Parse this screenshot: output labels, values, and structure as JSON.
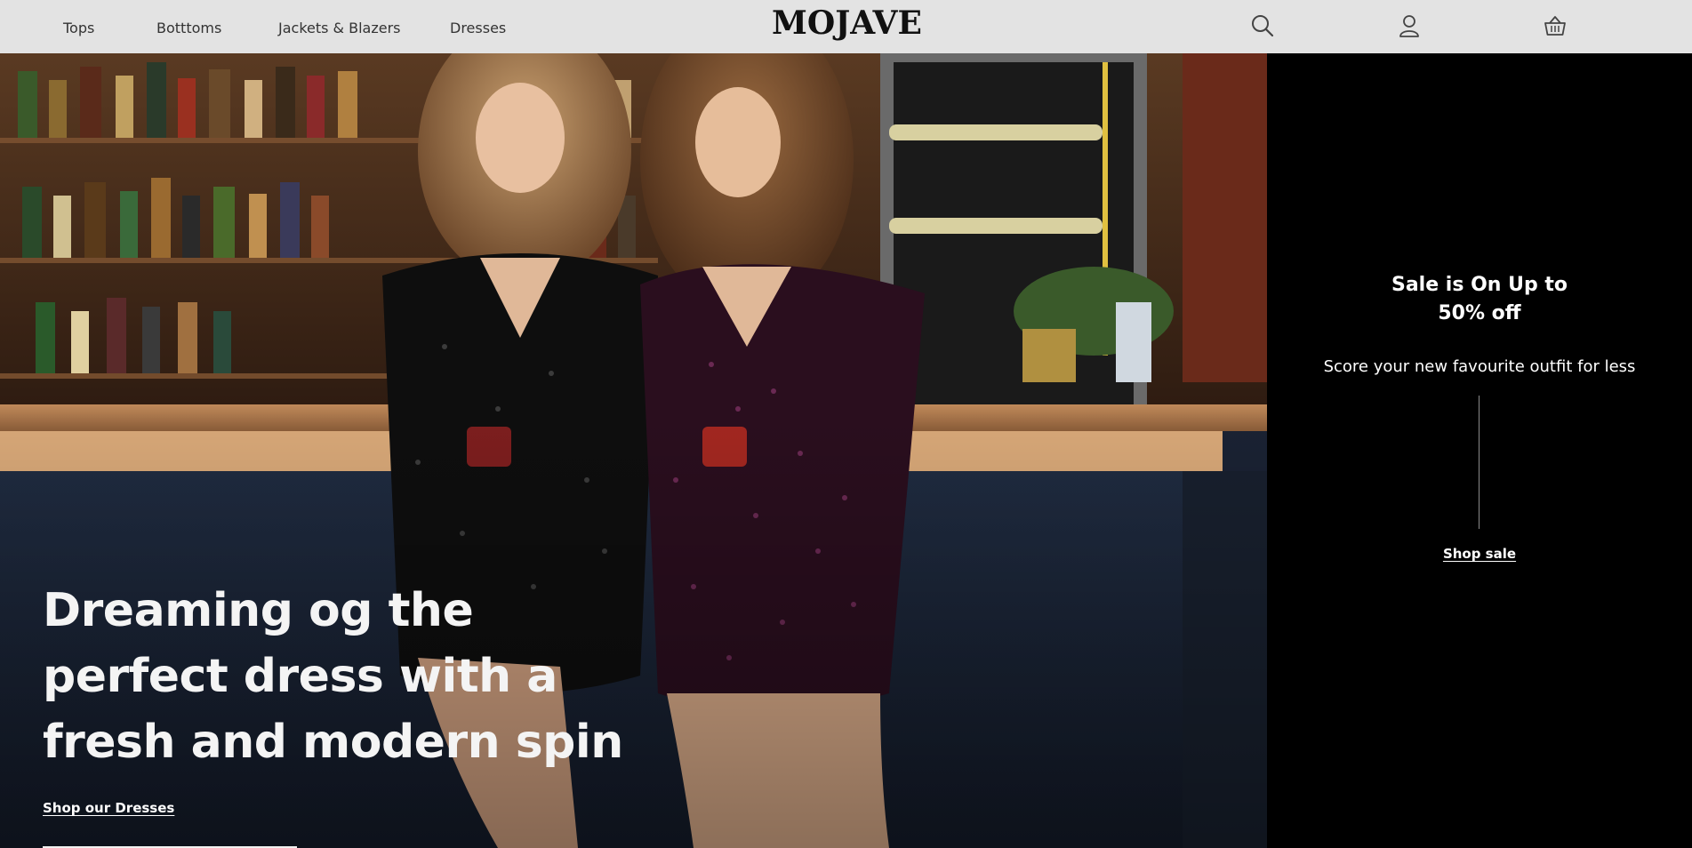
{
  "header": {
    "nav": [
      {
        "label": "Tops"
      },
      {
        "label": "Botttoms"
      },
      {
        "label": "Jackets & Blazers"
      },
      {
        "label": "Dresses"
      }
    ],
    "logo": "MOJAVE",
    "icons": [
      "search-icon",
      "account-icon",
      "basket-icon"
    ]
  },
  "hero": {
    "heading": "Dreaming og the perfect dress with a fresh and modern spin",
    "link": "Shop our Dresses"
  },
  "sale": {
    "heading": "Sale is On Up to 50% off",
    "subtitle": "Score your new favourite outfit for less",
    "link": "Shop sale"
  },
  "colors": {
    "header_bg": "#e3e3e3",
    "panel_bg": "#000000",
    "hero_text": "#f4f4f4"
  }
}
